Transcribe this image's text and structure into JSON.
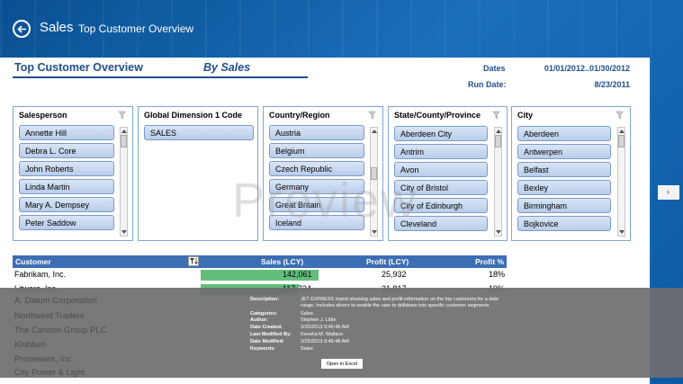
{
  "header": {
    "app_title": "Sales",
    "page_title": "Top Customer Overview"
  },
  "report": {
    "title": "Top Customer Overview",
    "subtitle": "By Sales",
    "dates_label": "Dates",
    "dates_value": "01/01/2012..01/30/2012",
    "run_date_label": "Run Date:",
    "run_date_value": "8/23/2011"
  },
  "slicers": {
    "salesperson": {
      "title": "Salesperson",
      "items": [
        "Annette Hill",
        "Debra L. Core",
        "John Roberts",
        "Linda Martin",
        "Mary A. Dempsey",
        "Peter Saddow"
      ]
    },
    "dimension": {
      "title": "Global Dimension 1 Code",
      "items": [
        "SALES"
      ]
    },
    "country": {
      "title": "Country/Region",
      "items": [
        "Austria",
        "Belgium",
        "Czech Republic",
        "Germany",
        "Great Britain",
        "Iceland"
      ]
    },
    "state": {
      "title": "State/County/Province",
      "items": [
        "Aberdeen City",
        "Antrim",
        "Avon",
        "City of Bristol",
        "City of Edinburgh",
        "Cleveland"
      ]
    },
    "city": {
      "title": "City",
      "items": [
        "Aberdeen",
        "Antwerpen",
        "Belfast",
        "Bexley",
        "Birmingham",
        "Bojkovice"
      ]
    }
  },
  "watermark": "Preview",
  "table": {
    "headers": {
      "customer": "Customer",
      "sales": "Sales (LCY)",
      "profit": "Profit (LCY)",
      "profit_pct": "Profit %"
    },
    "rows": [
      {
        "customer": "Fabrikam, Inc.",
        "sales": "142,061",
        "profit": "25,932",
        "profit_pct": "18%",
        "bar_fraction": 1.0
      },
      {
        "customer": "Litware, Inc.",
        "sales": "117,724",
        "profit": "21,817",
        "profit_pct": "19%",
        "bar_fraction": 0.83
      }
    ],
    "dimmed_customers": [
      "A. Datum Corporation",
      "Northwind Traders",
      "The Cannon Group PLC",
      "Klubben",
      "Proseware, Inc.",
      "City Power & Light"
    ]
  },
  "info": {
    "description_label": "Description:",
    "description": "JET EXPRESS report showing sales and profit information on the top customers for a date range.  Includes slicers to enable the user to drilldown into specific customer segments",
    "categories_label": "Categories:",
    "categories": "Sales",
    "author_label": "Author:",
    "author": "Stephen J. Little",
    "created_label": "Date Created:",
    "created": "2/25/2013 9:46:48 AM",
    "modified_by_label": "Last Modified By:",
    "modified_by": "Keesha M. Wallace",
    "modified_label": "Date Modified:",
    "modified": "2/25/2013 9:46:48 AM",
    "keywords_label": "Keywords:",
    "keywords": "Sales",
    "open_button": "Open in Excel"
  },
  "side_nav": {
    "label": "›"
  },
  "colors": {
    "header_bg": "#0d5ea8",
    "title_blue": "#1f4e8c",
    "table_head": "#3c6eb4",
    "data_bar": "#63be7b"
  }
}
